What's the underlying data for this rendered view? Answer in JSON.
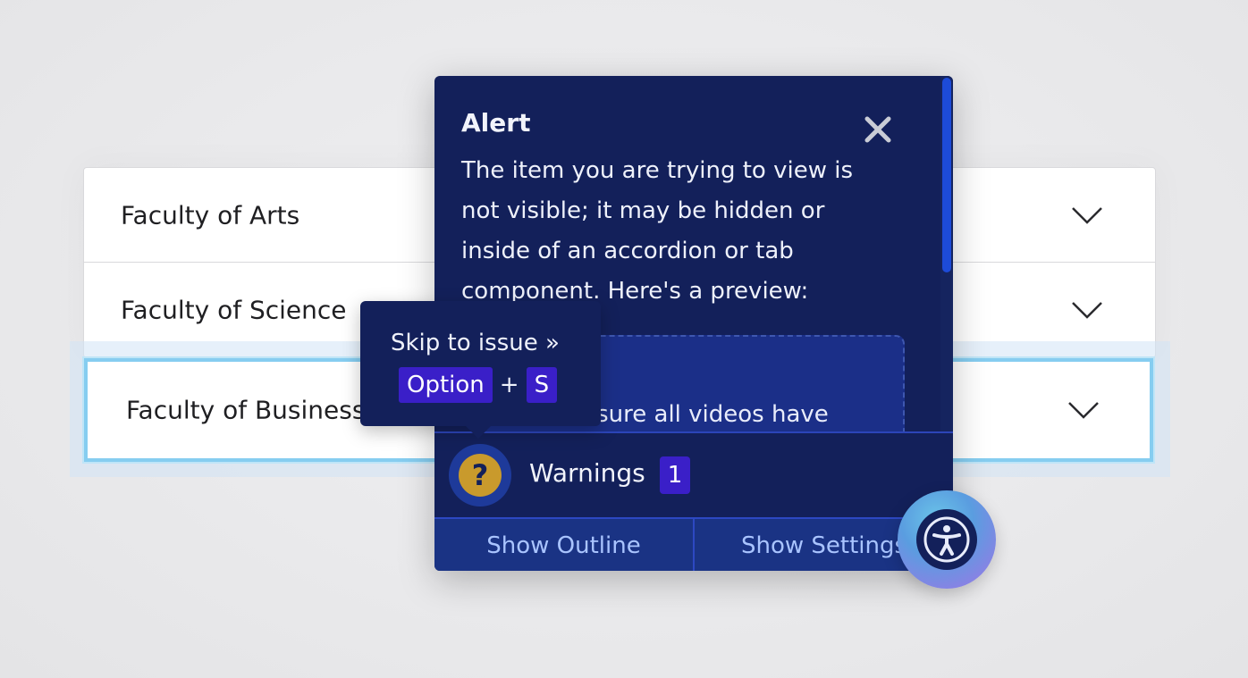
{
  "accordion": {
    "items": [
      {
        "label": "Faculty of Arts"
      },
      {
        "label": "Faculty of Science"
      },
      {
        "label": "Faculty of Business"
      }
    ]
  },
  "panel": {
    "alert_title": "Alert",
    "alert_text": "The item you are trying to view is not visible; it may be hidden or inside of an accordion or tab component. Here's a preview:",
    "preview_text": "Please ensure all videos have",
    "warnings_label": "Warnings",
    "warnings_count": "1",
    "show_outline_label": "Show Outline",
    "show_settings_label": "Show Settings",
    "warning_icon_glyph": "?"
  },
  "tooltip": {
    "title": "Skip to issue »",
    "key1": "Option",
    "plus": "+",
    "key2": "S"
  },
  "colors": {
    "panel_bg": "#13205a",
    "accent_purple": "#3a1fc8",
    "warning_gold": "#c99a2c",
    "focus_outline": "#86cdf0",
    "link_blue": "#a9c4ff"
  },
  "icons": {
    "close": "close-icon",
    "chevron": "chevron-down-icon",
    "warning": "question-icon",
    "accessibility": "accessibility-icon"
  }
}
